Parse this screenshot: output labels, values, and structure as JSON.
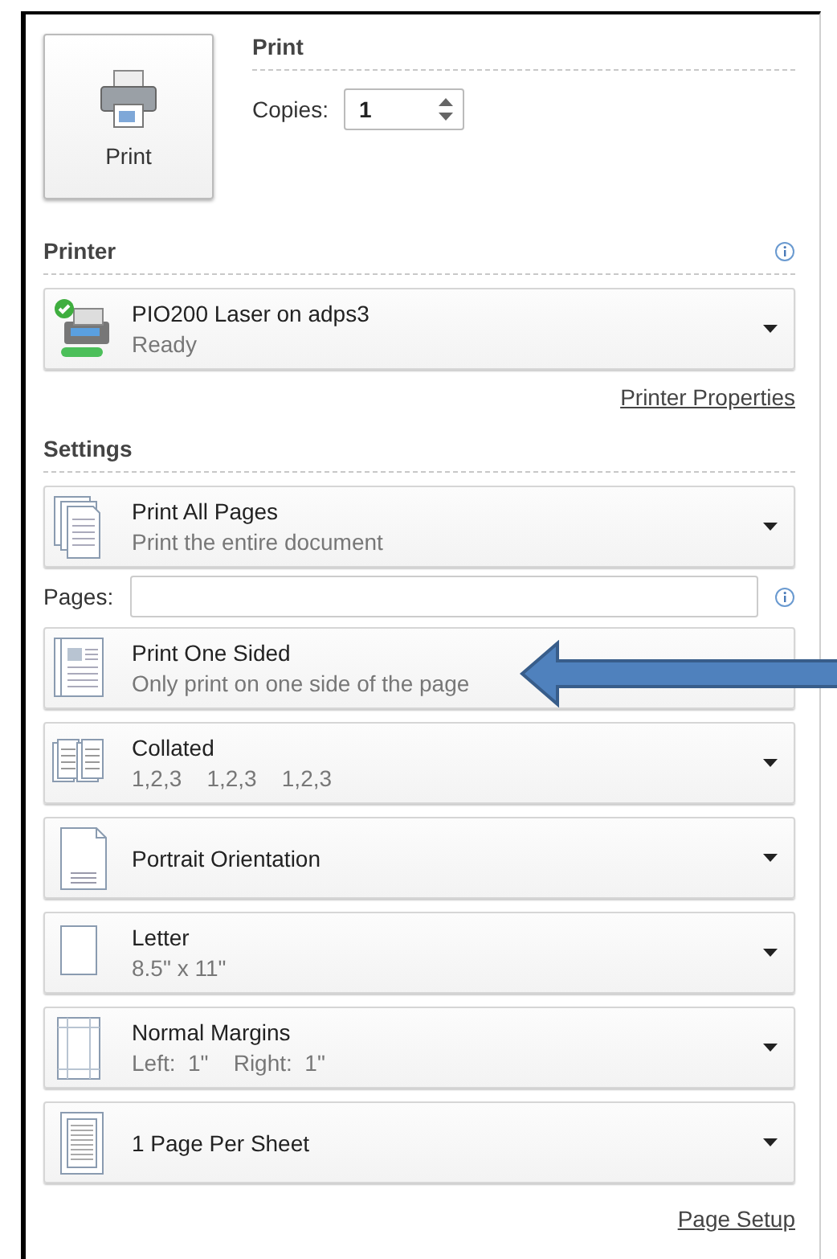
{
  "print_button": {
    "label": "Print"
  },
  "print_section": {
    "title": "Print",
    "copies_label": "Copies:",
    "copies": "1"
  },
  "printer": {
    "title": "Printer",
    "name": "PIO200 Laser on adps3",
    "status": "Ready",
    "ready": true,
    "properties_link": "Printer Properties"
  },
  "settings": {
    "title": "Settings",
    "items": [
      {
        "kind": "dropdown",
        "title": "Print All Pages",
        "subtitle": "Print the entire document"
      },
      {
        "kind": "field",
        "label": "Pages:"
      },
      {
        "kind": "dropdown",
        "title": "Print One Sided",
        "subtitle": "Only print on one side of the page"
      },
      {
        "kind": "dropdown",
        "title": "Collated",
        "subtitle": "1,2,3    1,2,3    1,2,3"
      },
      {
        "kind": "dropdown",
        "title": "Portrait Orientation"
      },
      {
        "kind": "dropdown",
        "title": "Letter",
        "subtitle": "8.5\" x 11\""
      },
      {
        "kind": "dropdown",
        "title": "Normal Margins",
        "subtitle": "Left:  1\"    Right:  1\""
      },
      {
        "kind": "dropdown",
        "title": "1 Page Per Sheet"
      }
    ]
  },
  "page_setup_link": "Page Setup"
}
